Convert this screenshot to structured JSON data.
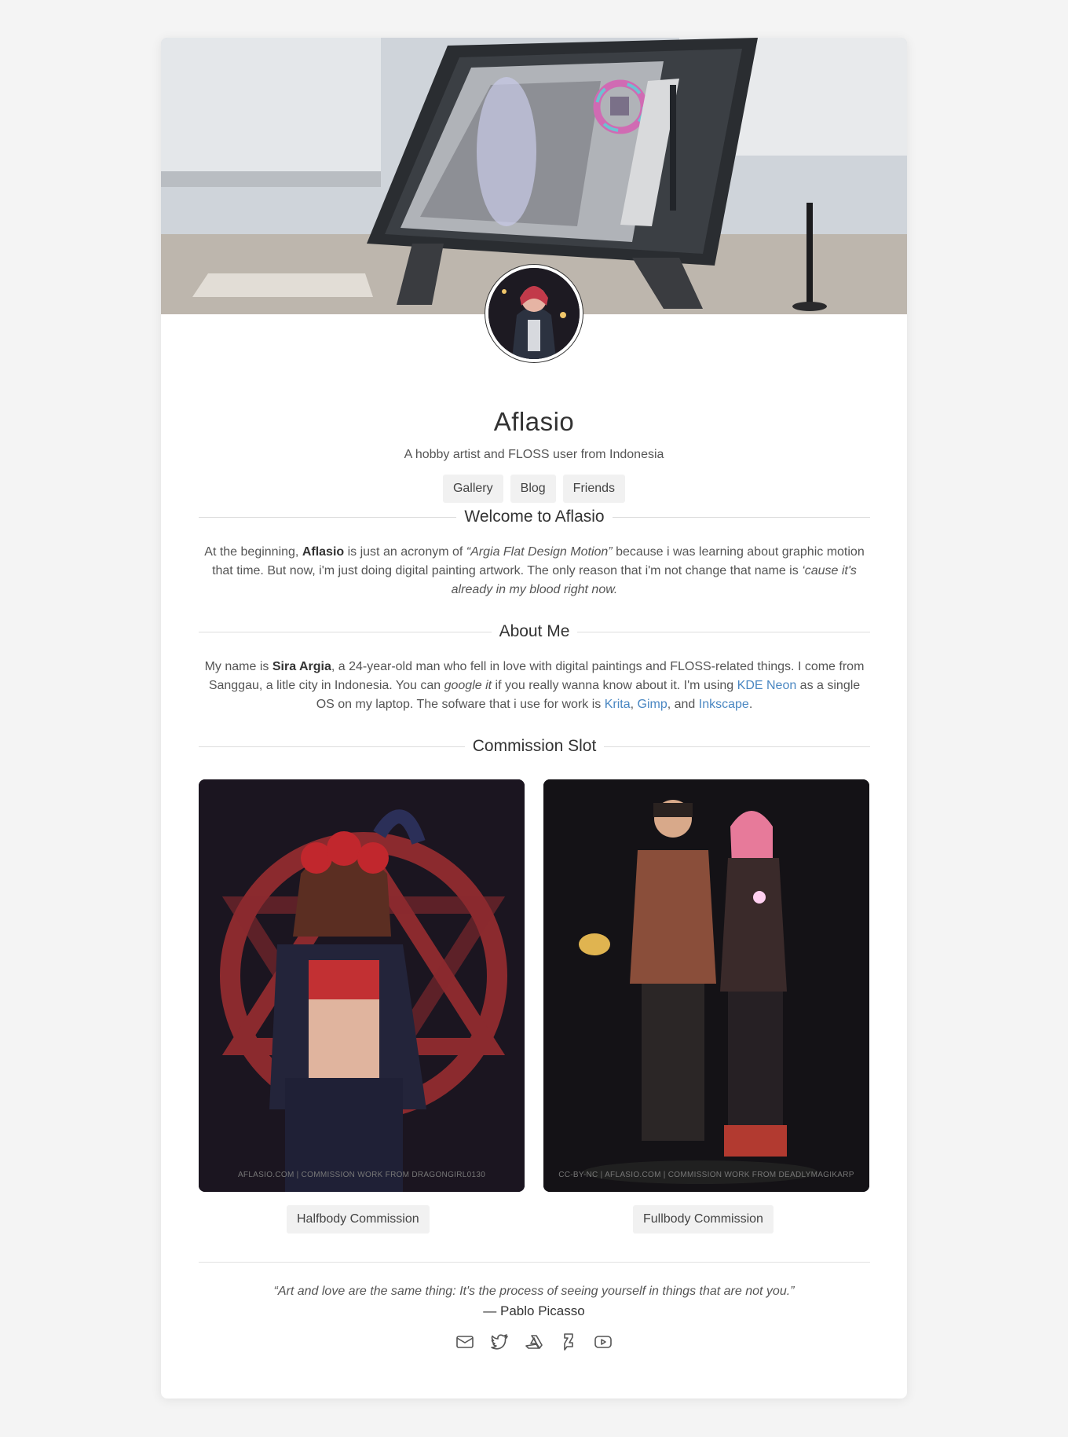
{
  "profile": {
    "name": "Aflasio",
    "tagline": "A hobby artist and FLOSS user from Indonesia"
  },
  "nav": [
    "Gallery",
    "Blog",
    "Friends"
  ],
  "welcome": {
    "title": "Welcome to Aflasio",
    "p1": "At the beginning, ",
    "name": "Aflasio",
    "p2": " is just an acronym of ",
    "acronym": "“Argia Flat Design Motion”",
    "p3": " because i was learning about graphic motion that time. But now, i'm just doing digital painting artwork. The only reason that i'm not change that name is ",
    "reason": "‘cause it's already in my blood right now."
  },
  "about": {
    "title": "About Me",
    "p1": "My name is ",
    "fullname": "Sira Argia",
    "p2": ", a 24-year-old man who fell in love with digital paintings and FLOSS-related things. I come from Sanggau, a litle city in Indonesia. You can ",
    "google": "google it",
    "p3": " if you really wanna know about it. I'm using ",
    "os": "KDE Neon",
    "p4": " as a single OS on my laptop. The sofware that i use for work is ",
    "krita": "Krita",
    "sep1": ", ",
    "gimp": "Gimp",
    "sep2": ", and ",
    "inkscape": "Inkscape",
    "end": "."
  },
  "commission": {
    "title": "Commission Slot",
    "items": [
      {
        "label": "Halfbody Commission",
        "caption": "AFLASIO.COM | COMMISSION WORK FROM DRAGONGIRL0130"
      },
      {
        "label": "Fullbody Commission",
        "caption": "CC-BY-NC | AFLASIO.COM | COMMISSION WORK FROM DEADLYMAGIKARP"
      }
    ]
  },
  "quote": {
    "text": "“Art and love are the same thing: It's the process of seeing yourself in things that are not you.”",
    "author": "— Pablo Picasso"
  },
  "socials": [
    "mail-icon",
    "twitter-icon",
    "artstation-icon",
    "deviantart-icon",
    "youtube-icon"
  ],
  "colors": {
    "link": "#4a87c2",
    "text": "#555555",
    "background": "#f4f4f4",
    "button": "#f1f1f1"
  }
}
